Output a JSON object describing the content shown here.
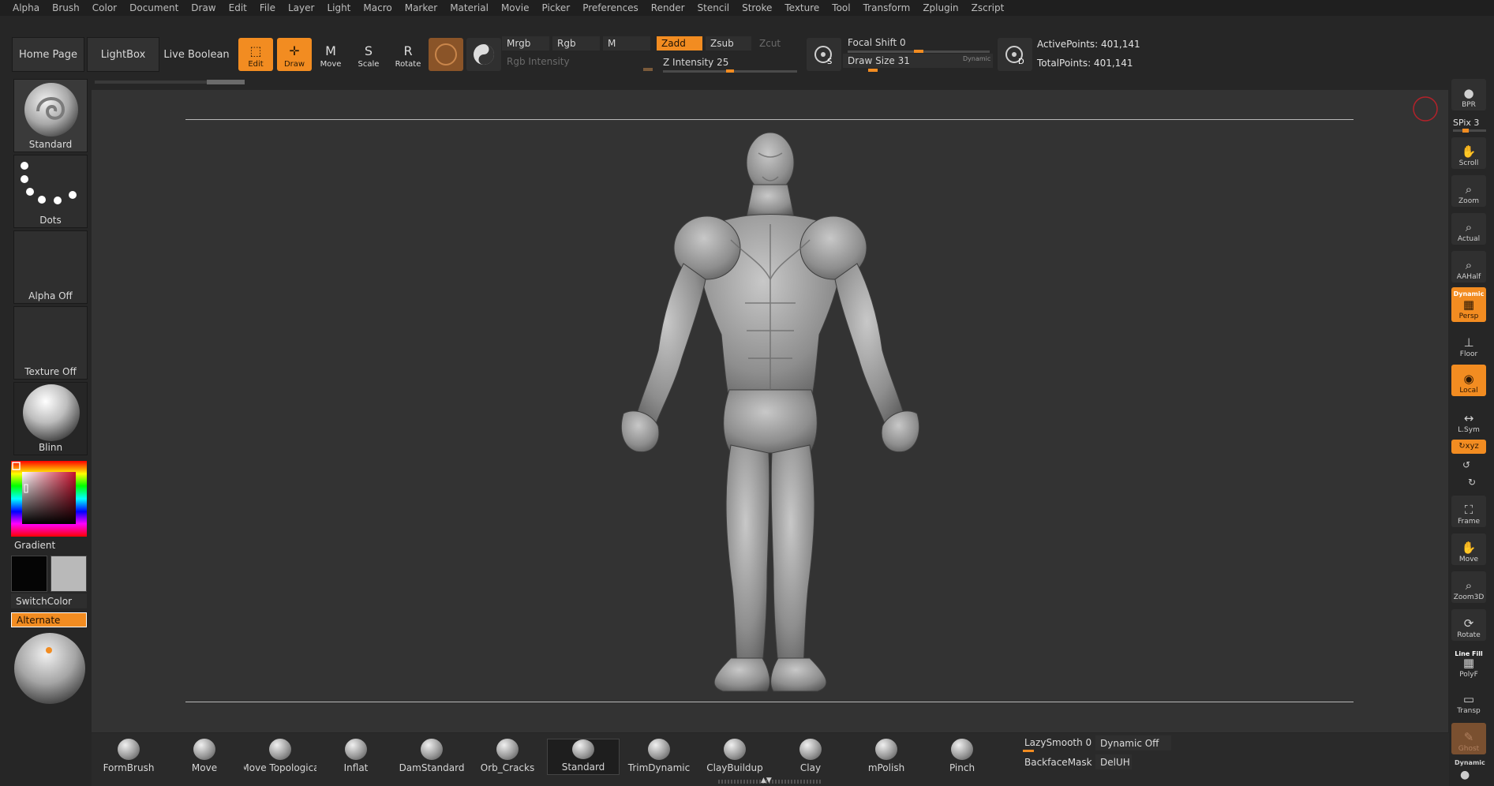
{
  "menu": [
    "Alpha",
    "Brush",
    "Color",
    "Document",
    "Draw",
    "Edit",
    "File",
    "Layer",
    "Light",
    "Macro",
    "Marker",
    "Material",
    "Movie",
    "Picker",
    "Preferences",
    "Render",
    "Stencil",
    "Stroke",
    "Texture",
    "Tool",
    "Transform",
    "Zplugin",
    "Zscript"
  ],
  "nav": {
    "home": "Home Page",
    "lightbox": "LightBox",
    "live_boolean": "Live Boolean"
  },
  "tools": {
    "edit": "Edit",
    "draw": "Draw",
    "move": "Move",
    "scale": "Scale",
    "rotate": "Rotate"
  },
  "color_modes": {
    "mrgb": "Mrgb",
    "rgb": "Rgb",
    "m": "M",
    "rgb_intensity": "Rgb Intensity"
  },
  "z_modes": {
    "zadd": "Zadd",
    "zsub": "Zsub",
    "zcut": "Zcut",
    "z_intensity": "Z Intensity 25",
    "z_intensity_value": 25
  },
  "stroke": {
    "focal_shift": "Focal Shift 0",
    "draw_size": "Draw Size 31",
    "dynamic": "Dynamic",
    "focal_value": 0,
    "draw_size_value": 31
  },
  "stats": {
    "active_points": "ActivePoints: 401,141",
    "total_points": "TotalPoints: 401,141"
  },
  "left": {
    "brush": "Standard",
    "stroke": "Dots",
    "alpha": "Alpha Off",
    "texture": "Texture Off",
    "material": "Blinn",
    "gradient": "Gradient",
    "switch_color": "SwitchColor",
    "alternate": "Alternate"
  },
  "right": {
    "bpr": "BPR",
    "spix": "SPix 3",
    "scroll": "Scroll",
    "zoom": "Zoom",
    "actual": "Actual",
    "aahalf": "AAHalf",
    "dynamic": "Dynamic",
    "persp": "Persp",
    "floor": "Floor",
    "local": "Local",
    "lsym": "L.Sym",
    "xyz": "↻xyz",
    "frame": "Frame",
    "move": "Move",
    "zoom3d": "Zoom3D",
    "rotate": "Rotate",
    "line_fill": "Line Fill",
    "polyf": "PolyF",
    "transp": "Transp",
    "ghost": "Ghost",
    "dynamic2": "Dynamic"
  },
  "brushes": [
    "FormBrush",
    "Move",
    "Move Topologica",
    "Inflat",
    "DamStandard",
    "Orb_Cracks",
    "Standard",
    "TrimDynamic",
    "ClayBuildup",
    "Clay",
    "mPolish",
    "Pinch"
  ],
  "bottom": {
    "lazy_smooth": "LazySmooth 0",
    "dynamic_off": "Dynamic Off",
    "backface_mask": "BackfaceMask",
    "deluh": "DelUH"
  },
  "colors": {
    "accent": "#f28c21",
    "viewport": "#333333",
    "panel": "#262626"
  }
}
